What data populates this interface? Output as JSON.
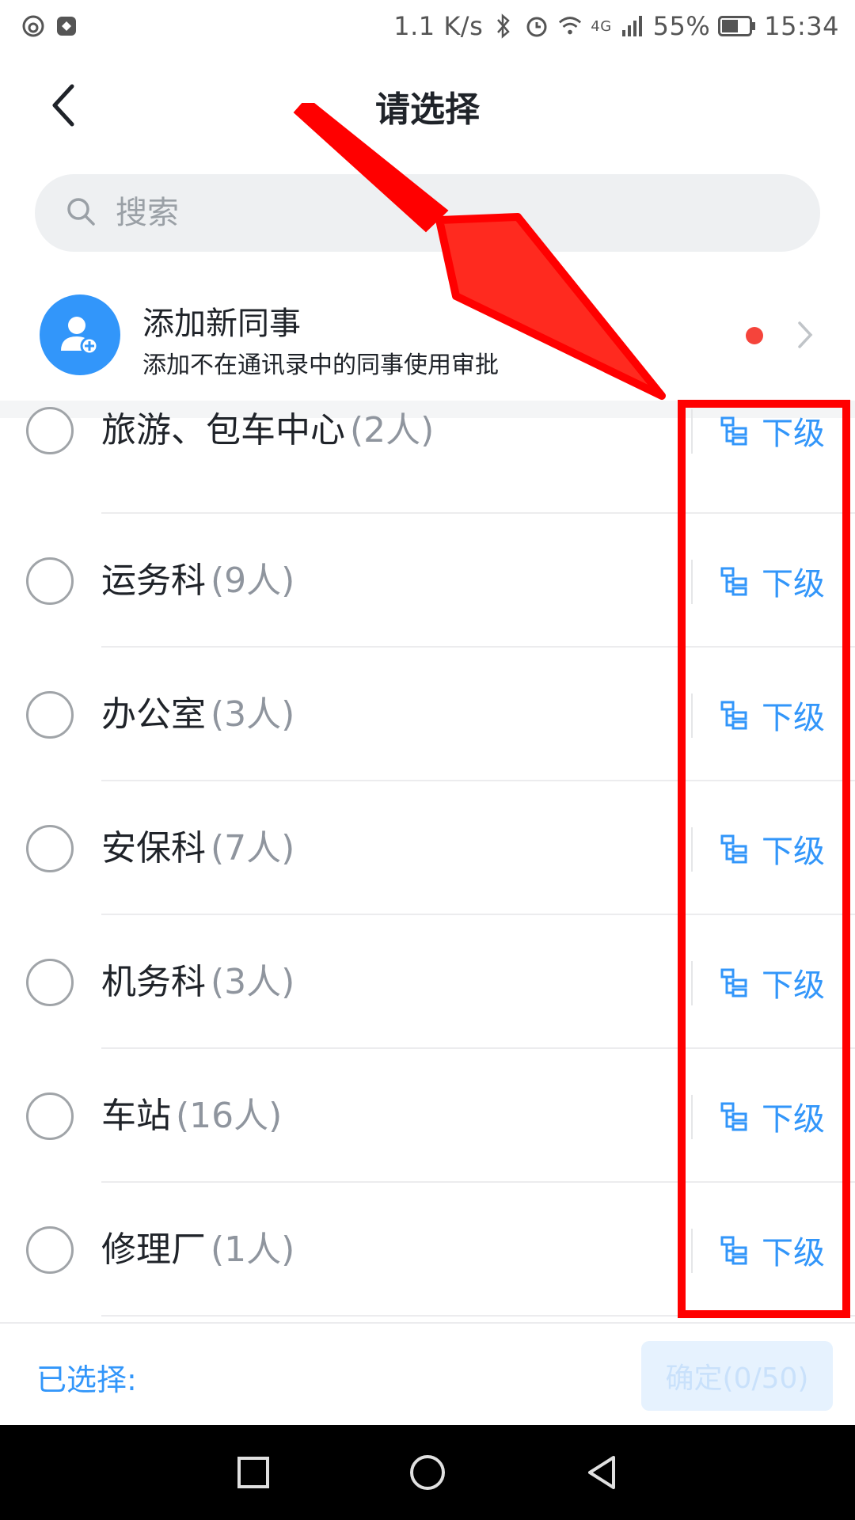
{
  "status_bar": {
    "speed": "1.1 K/s",
    "network": "4G",
    "battery": "55%",
    "time": "15:34"
  },
  "header": {
    "title": "请选择"
  },
  "search": {
    "placeholder": "搜索"
  },
  "add_colleague": {
    "title": "添加新同事",
    "subtitle": "添加不在通讯录中的同事使用审批"
  },
  "departments": [
    {
      "name": "旅游、包车中心",
      "count": "(2人)",
      "sub_label": "下级"
    },
    {
      "name": "运务科",
      "count": "(9人)",
      "sub_label": "下级"
    },
    {
      "name": "办公室",
      "count": "(3人)",
      "sub_label": "下级"
    },
    {
      "name": "安保科",
      "count": "(7人)",
      "sub_label": "下级"
    },
    {
      "name": "机务科",
      "count": "(3人)",
      "sub_label": "下级"
    },
    {
      "name": "车站",
      "count": "(16人)",
      "sub_label": "下级"
    },
    {
      "name": "修理厂",
      "count": "(1人)",
      "sub_label": "下级"
    }
  ],
  "footer": {
    "selected_label": "已选择:",
    "confirm_label": "确定(0/50)"
  },
  "colors": {
    "accent": "#3296fa",
    "annotation": "#ff0000",
    "notification_dot": "#f5443b"
  }
}
